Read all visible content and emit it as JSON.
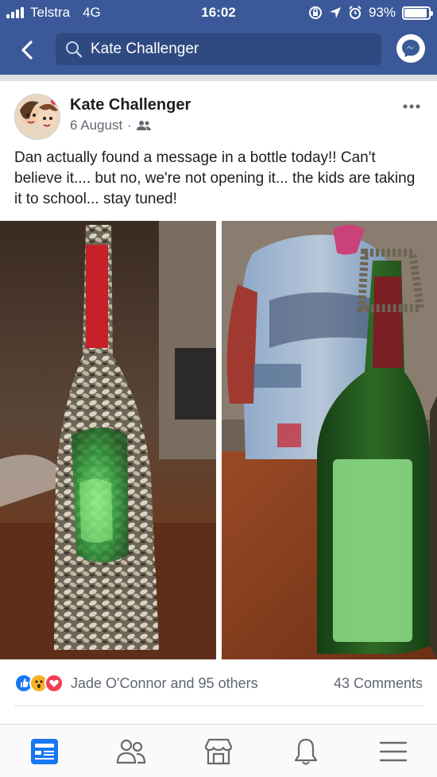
{
  "status_bar": {
    "carrier": "Telstra",
    "network": "4G",
    "time": "16:02",
    "battery_percent": "93%",
    "battery_level": 0.93
  },
  "nav": {
    "search_value": "Kate Challenger"
  },
  "post": {
    "author": "Kate Challenger",
    "date": "6 August",
    "dot": "·",
    "text": "Dan actually found a message in a bottle today!! Can't believe it.... but no, we're not opening it... the kids are taking it to school... stay tuned!",
    "reactions_summary": "Jade O'Connor and 95 others",
    "comments_count": "43 Comments",
    "reaction_types": [
      "like-icon",
      "wow-icon",
      "love-icon"
    ]
  },
  "tabs": [
    {
      "name": "news-feed",
      "icon": "newsfeed-icon",
      "active": true
    },
    {
      "name": "friends",
      "icon": "friends-icon",
      "active": false
    },
    {
      "name": "marketplace",
      "icon": "marketplace-icon",
      "active": false
    },
    {
      "name": "notifications",
      "icon": "bell-icon",
      "active": false
    },
    {
      "name": "menu",
      "icon": "menu-icon",
      "active": false
    }
  ],
  "colors": {
    "brand_blue": "#3b5998",
    "like_blue": "#1877f2",
    "love_red": "#f33e58",
    "wow_yellow": "#f7b125"
  }
}
